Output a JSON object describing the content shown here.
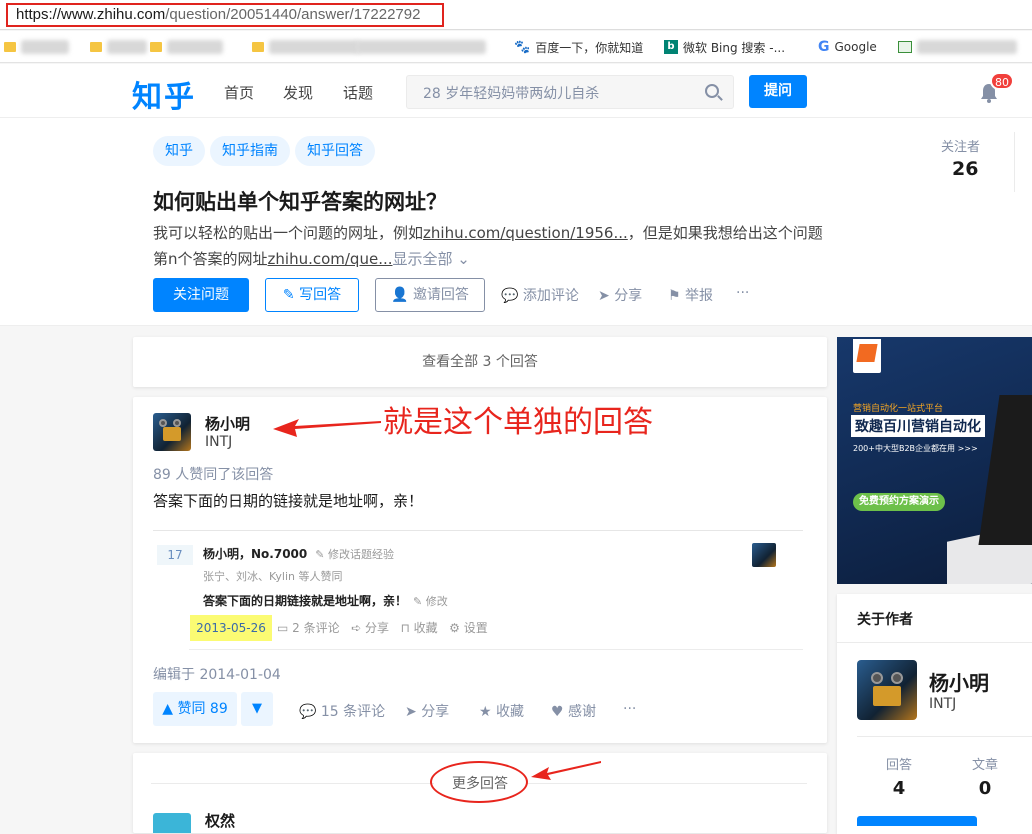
{
  "browser": {
    "url_host": "https://www.zhihu.com",
    "url_path": "/question/20051440/answer/17222792",
    "bookmarks": [
      {
        "label": "百度一下，你就知道"
      },
      {
        "label": "微软 Bing 搜索 -..."
      },
      {
        "label": "Google"
      }
    ]
  },
  "nav": {
    "logo": "知乎",
    "links": [
      "首页",
      "发现",
      "话题"
    ],
    "search_placeholder": "28 岁年轻妈妈带两幼儿自杀",
    "ask_label": "提问",
    "notification_count": "80"
  },
  "question": {
    "tags": [
      "知乎",
      "知乎指南",
      "知乎回答"
    ],
    "title": "如何贴出单个知乎答案的网址？",
    "desc_line1_a": "我可以轻松的贴出一个问题的网址，例如",
    "desc_line1_link": "zhihu.com/question/1956...",
    "desc_line1_b": "，但是如果我想给出这个问题",
    "desc_line2_a": "第n个答案的网址",
    "desc_line2_link": "zhihu.com/que...",
    "show_all": "显示全部",
    "follow_label": "关注问题",
    "write_label": "写回答",
    "invite_label": "邀请回答",
    "comment_label": "添加评论",
    "share_label": "分享",
    "report_label": "举报",
    "more_label": "···",
    "followers_label": "关注者",
    "followers_count": "26"
  },
  "view_all_label": "查看全部 3 个回答",
  "answer": {
    "author": "杨小明",
    "bio": "INTJ",
    "annotation": "就是这个单独的回答",
    "vote_summary": "89 人赞同了该回答",
    "body": "答案下面的日期的链接就是地址啊，亲！",
    "inner": {
      "votes": "17",
      "name": "杨小明，No.7000",
      "edit_sig": "修改话题经验",
      "voters": "张宁、刘冰、Kylin 等人赞同",
      "body": "答案下面的日期链接就是地址啊，亲！",
      "edit": "修改",
      "date": "2013-05-26",
      "comments": "2 条评论",
      "share": "分享",
      "collect": "收藏",
      "settings": "设置"
    },
    "edited": "编辑于 2014-01-04",
    "upvote_label": "赞同 89",
    "comments": "15 条评论",
    "share": "分享",
    "collect": "收藏",
    "thanks": "感谢",
    "more": "···"
  },
  "more_answers_label": "更多回答",
  "next_answer_author": "权然",
  "ad": {
    "sub": "营销自动化一站式平台",
    "title": "致趣百川营销自动化",
    "line": "200+中大型B2B企业都在用 >>>",
    "cta": "免费预约方案演示"
  },
  "about": {
    "title": "关于作者",
    "name": "杨小明",
    "bio": "INTJ",
    "answers_label": "回答",
    "answers_count": "4",
    "articles_label": "文章",
    "articles_count": "0"
  },
  "colors": {
    "brand": "#0084ff",
    "annotation": "#e8251d",
    "highlight": "#fbfb73"
  }
}
